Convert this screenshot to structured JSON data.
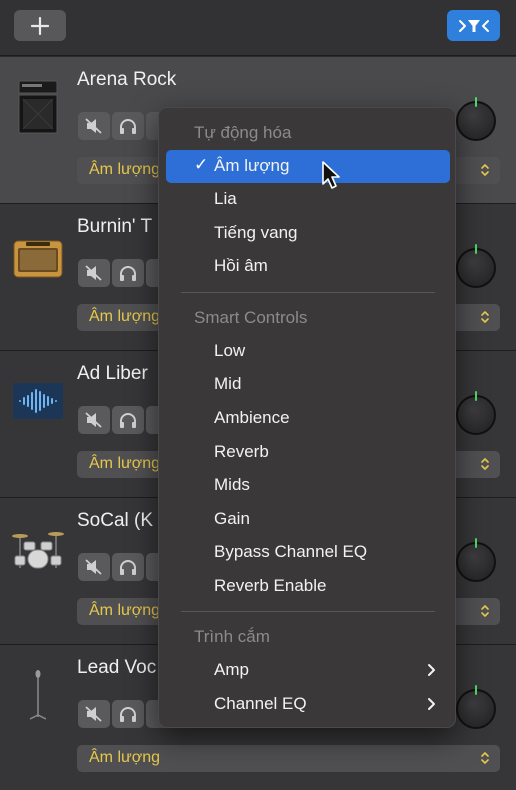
{
  "toolbar": {
    "add_label": "+",
    "filter_icon": "filter-icon"
  },
  "tracks": [
    {
      "name": "Arena Rock",
      "automation": "Âm lượng",
      "icon": "amp-stack-icon"
    },
    {
      "name": "Burnin' T",
      "automation": "Âm lượng",
      "icon": "combo-amp-icon"
    },
    {
      "name": "Ad Liber",
      "automation": "Âm lượng",
      "icon": "waveform-icon"
    },
    {
      "name": "SoCal (K",
      "automation": "Âm lượng",
      "icon": "drum-kit-icon"
    },
    {
      "name": "Lead Voc",
      "automation": "Âm lượng",
      "icon": "microphone-icon"
    }
  ],
  "menu": {
    "section_automation": "Tự động hóa",
    "checkmark": "✓",
    "automation_items": [
      "Âm lượng",
      "Lia",
      "Tiếng vang",
      "Hồi âm"
    ],
    "section_smart": "Smart Controls",
    "smart_items": [
      "Low",
      "Mid",
      "Ambience",
      "Reverb",
      "Mids",
      "Gain",
      "Bypass Channel EQ",
      "Reverb Enable"
    ],
    "section_plugins": "Trình cắm",
    "plugin_items": [
      "Amp",
      "Channel EQ"
    ]
  },
  "colors": {
    "accent": "#2f7fdc",
    "automation_text": "#e6c94a",
    "highlight": "#2d6fd6"
  }
}
